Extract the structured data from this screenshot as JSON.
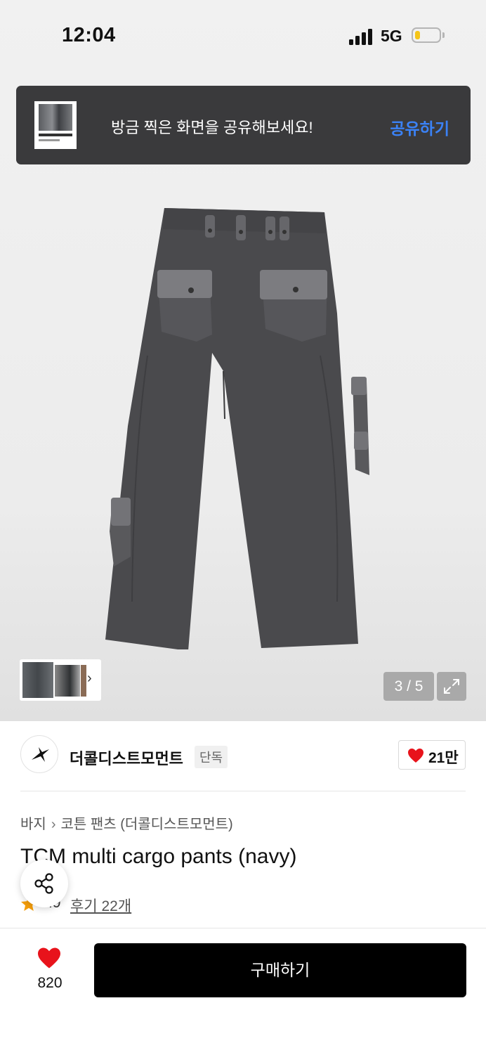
{
  "status_bar": {
    "time": "12:04",
    "network": "5G",
    "battery_level": 0.22
  },
  "share_toast": {
    "message": "방금 찍은 화면을 공유해보세요!",
    "action": "공유하기"
  },
  "product_image": {
    "alt": "TCM multi cargo pants (navy)"
  },
  "gallery": {
    "counter": "3 / 5"
  },
  "brand": {
    "name": "더콜디스트모먼트",
    "badge": "단독",
    "likes": "21만"
  },
  "breadcrumb": {
    "category": "바지",
    "subcategory": "코튼 팬츠 (더콜디스트모먼트)"
  },
  "product": {
    "title": "TCM multi cargo pants (navy)",
    "rating": ".9",
    "reviews": "후기 22개"
  },
  "bottom_bar": {
    "like_count": "820",
    "buy_label": "구매하기"
  },
  "colors": {
    "accent_blue": "#3b82f6",
    "heart_red": "#e8131b",
    "star_orange": "#f59e0b"
  }
}
